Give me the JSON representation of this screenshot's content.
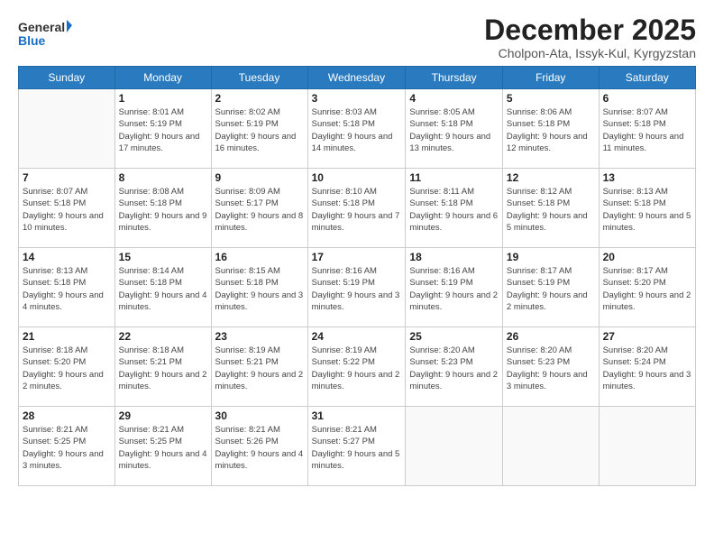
{
  "header": {
    "logo_line1": "General",
    "logo_line2": "Blue",
    "month_title": "December 2025",
    "subtitle": "Cholpon-Ata, Issyk-Kul, Kyrgyzstan"
  },
  "days_of_week": [
    "Sunday",
    "Monday",
    "Tuesday",
    "Wednesday",
    "Thursday",
    "Friday",
    "Saturday"
  ],
  "weeks": [
    [
      {
        "day": "",
        "sunrise": "",
        "sunset": "",
        "daylight": ""
      },
      {
        "day": "1",
        "sunrise": "8:01 AM",
        "sunset": "5:19 PM",
        "daylight": "9 hours and 17 minutes."
      },
      {
        "day": "2",
        "sunrise": "8:02 AM",
        "sunset": "5:19 PM",
        "daylight": "9 hours and 16 minutes."
      },
      {
        "day": "3",
        "sunrise": "8:03 AM",
        "sunset": "5:18 PM",
        "daylight": "9 hours and 14 minutes."
      },
      {
        "day": "4",
        "sunrise": "8:05 AM",
        "sunset": "5:18 PM",
        "daylight": "9 hours and 13 minutes."
      },
      {
        "day": "5",
        "sunrise": "8:06 AM",
        "sunset": "5:18 PM",
        "daylight": "9 hours and 12 minutes."
      },
      {
        "day": "6",
        "sunrise": "8:07 AM",
        "sunset": "5:18 PM",
        "daylight": "9 hours and 11 minutes."
      }
    ],
    [
      {
        "day": "7",
        "sunrise": "8:07 AM",
        "sunset": "5:18 PM",
        "daylight": "9 hours and 10 minutes."
      },
      {
        "day": "8",
        "sunrise": "8:08 AM",
        "sunset": "5:18 PM",
        "daylight": "9 hours and 9 minutes."
      },
      {
        "day": "9",
        "sunrise": "8:09 AM",
        "sunset": "5:17 PM",
        "daylight": "9 hours and 8 minutes."
      },
      {
        "day": "10",
        "sunrise": "8:10 AM",
        "sunset": "5:18 PM",
        "daylight": "9 hours and 7 minutes."
      },
      {
        "day": "11",
        "sunrise": "8:11 AM",
        "sunset": "5:18 PM",
        "daylight": "9 hours and 6 minutes."
      },
      {
        "day": "12",
        "sunrise": "8:12 AM",
        "sunset": "5:18 PM",
        "daylight": "9 hours and 5 minutes."
      },
      {
        "day": "13",
        "sunrise": "8:13 AM",
        "sunset": "5:18 PM",
        "daylight": "9 hours and 5 minutes."
      }
    ],
    [
      {
        "day": "14",
        "sunrise": "8:13 AM",
        "sunset": "5:18 PM",
        "daylight": "9 hours and 4 minutes."
      },
      {
        "day": "15",
        "sunrise": "8:14 AM",
        "sunset": "5:18 PM",
        "daylight": "9 hours and 4 minutes."
      },
      {
        "day": "16",
        "sunrise": "8:15 AM",
        "sunset": "5:18 PM",
        "daylight": "9 hours and 3 minutes."
      },
      {
        "day": "17",
        "sunrise": "8:16 AM",
        "sunset": "5:19 PM",
        "daylight": "9 hours and 3 minutes."
      },
      {
        "day": "18",
        "sunrise": "8:16 AM",
        "sunset": "5:19 PM",
        "daylight": "9 hours and 2 minutes."
      },
      {
        "day": "19",
        "sunrise": "8:17 AM",
        "sunset": "5:19 PM",
        "daylight": "9 hours and 2 minutes."
      },
      {
        "day": "20",
        "sunrise": "8:17 AM",
        "sunset": "5:20 PM",
        "daylight": "9 hours and 2 minutes."
      }
    ],
    [
      {
        "day": "21",
        "sunrise": "8:18 AM",
        "sunset": "5:20 PM",
        "daylight": "9 hours and 2 minutes."
      },
      {
        "day": "22",
        "sunrise": "8:18 AM",
        "sunset": "5:21 PM",
        "daylight": "9 hours and 2 minutes."
      },
      {
        "day": "23",
        "sunrise": "8:19 AM",
        "sunset": "5:21 PM",
        "daylight": "9 hours and 2 minutes."
      },
      {
        "day": "24",
        "sunrise": "8:19 AM",
        "sunset": "5:22 PM",
        "daylight": "9 hours and 2 minutes."
      },
      {
        "day": "25",
        "sunrise": "8:20 AM",
        "sunset": "5:23 PM",
        "daylight": "9 hours and 2 minutes."
      },
      {
        "day": "26",
        "sunrise": "8:20 AM",
        "sunset": "5:23 PM",
        "daylight": "9 hours and 3 minutes."
      },
      {
        "day": "27",
        "sunrise": "8:20 AM",
        "sunset": "5:24 PM",
        "daylight": "9 hours and 3 minutes."
      }
    ],
    [
      {
        "day": "28",
        "sunrise": "8:21 AM",
        "sunset": "5:25 PM",
        "daylight": "9 hours and 3 minutes."
      },
      {
        "day": "29",
        "sunrise": "8:21 AM",
        "sunset": "5:25 PM",
        "daylight": "9 hours and 4 minutes."
      },
      {
        "day": "30",
        "sunrise": "8:21 AM",
        "sunset": "5:26 PM",
        "daylight": "9 hours and 4 minutes."
      },
      {
        "day": "31",
        "sunrise": "8:21 AM",
        "sunset": "5:27 PM",
        "daylight": "9 hours and 5 minutes."
      },
      {
        "day": "",
        "sunrise": "",
        "sunset": "",
        "daylight": ""
      },
      {
        "day": "",
        "sunrise": "",
        "sunset": "",
        "daylight": ""
      },
      {
        "day": "",
        "sunrise": "",
        "sunset": "",
        "daylight": ""
      }
    ]
  ]
}
